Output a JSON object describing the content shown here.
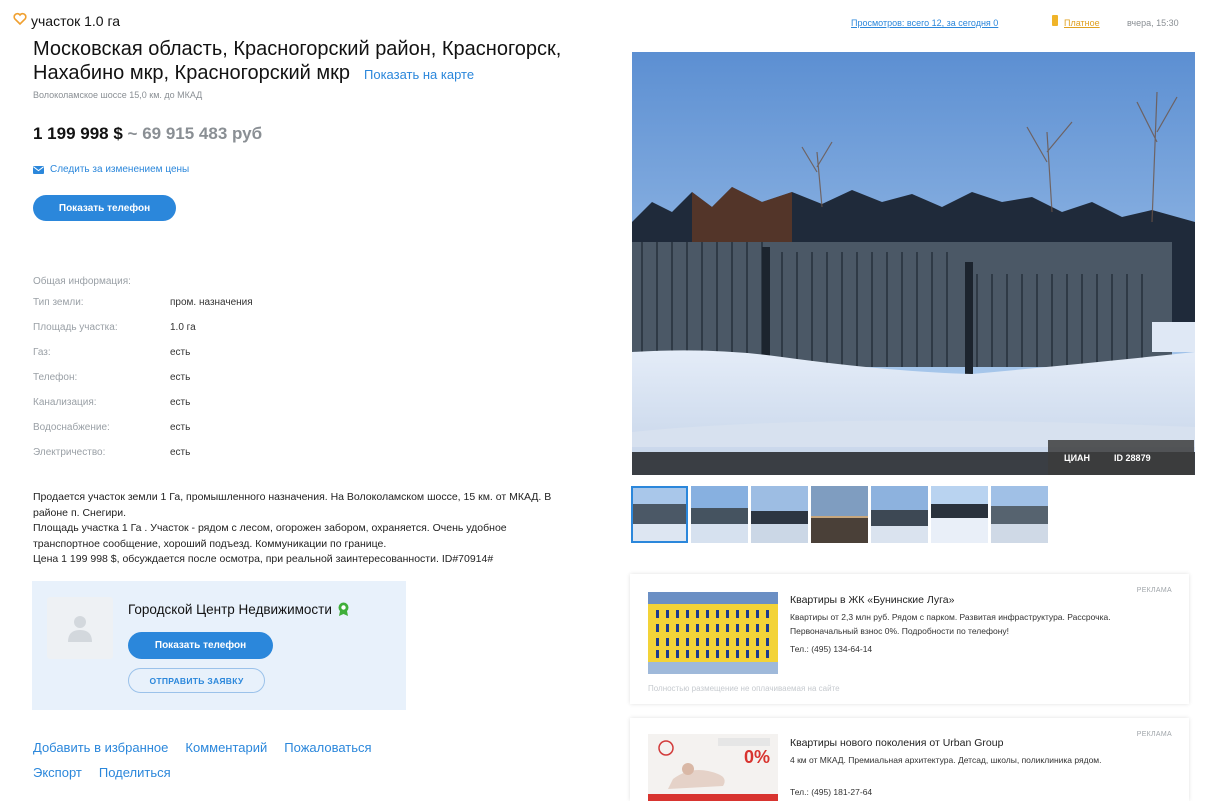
{
  "header": {
    "object_type": "участок 1.0 га",
    "title": "Московская область, Красногорский район, Красногорск, Нахабино мкр, Красногорский мкр",
    "map_link": "Показать на карте",
    "highway": "Волоколамское шоссе 15,0 км. до МКАД"
  },
  "price": {
    "usd": "1 199 998 $",
    "rub": "~ 69 915 483 руб",
    "follow_label": "Следить за изменением цены",
    "phone_button": "Показать телефон"
  },
  "meta": {
    "views": "Просмотров: всего 12, за сегодня 0",
    "paid": "Платное",
    "date": "вчера, 15:30"
  },
  "info": {
    "title": "Общая информация:",
    "rows": [
      {
        "label": "Тип земли:",
        "value": "пром. назначения"
      },
      {
        "label": "Площадь участка:",
        "value": "1.0 га"
      },
      {
        "label": "Газ:",
        "value": "есть"
      },
      {
        "label": "Телефон:",
        "value": "есть"
      },
      {
        "label": "Канализация:",
        "value": "есть"
      },
      {
        "label": "Водоснабжение:",
        "value": "есть"
      },
      {
        "label": "Электричество:",
        "value": "есть"
      }
    ]
  },
  "description": [
    "Продается участок земли 1 Га, промышленного назначения. На Волоколамском шоссе, 15 км. от МКАД. В районе п. Снегири.",
    "Площадь участка 1 Га . Участок - рядом с лесом, огорожен забором, охраняется. Очень удобное транспортное сообщение, хороший подъезд. Коммуникации по границе.",
    "Цена 1 199 998 $, обсуждается после осмотра, при реальной заинтересованности. ID#70914#"
  ],
  "agent": {
    "name": "Городской Центр Недвижимости",
    "phone_button": "Показать телефон",
    "apply_button": "ОТПРАВИТЬ ЗАЯВКУ"
  },
  "actions": {
    "favorite": "Добавить в избранное",
    "comment": "Комментарий",
    "complain": "Пожаловаться",
    "export": "Экспорт",
    "share": "Поделиться"
  },
  "photo": {
    "watermark": "ЦИАН",
    "id_label": "ID 28879",
    "thumbnail_count": 7
  },
  "ads": [
    {
      "label": "РЕКЛАМА",
      "title": "Квартиры в ЖК «Бунинские Луга»",
      "text": "Квартиры от 2,3 млн руб. Рядом с парком. Развитая инфраструктура. Рассрочка. Первоначальный взнос 0%. Подробности по телефону!",
      "tel": "Тел.: (495) 134-64-14",
      "footer": "Полностью размещение не оплачиваемая на сайте"
    },
    {
      "label": "РЕКЛАМА",
      "title": "Квартиры нового поколения от Urban Group",
      "text": "4 км от МКАД. Премиальная архитектура. Детсад, школы, поликлиника рядом.",
      "tel": "Тел.: (495) 181-27-64",
      "badge": "0%"
    }
  ],
  "colors": {
    "accent": "#2b87db",
    "paid": "#e0a020",
    "agent_card": "#e8f1fb",
    "sky_top": "#5f93d4",
    "snow": "#e6eef8"
  }
}
